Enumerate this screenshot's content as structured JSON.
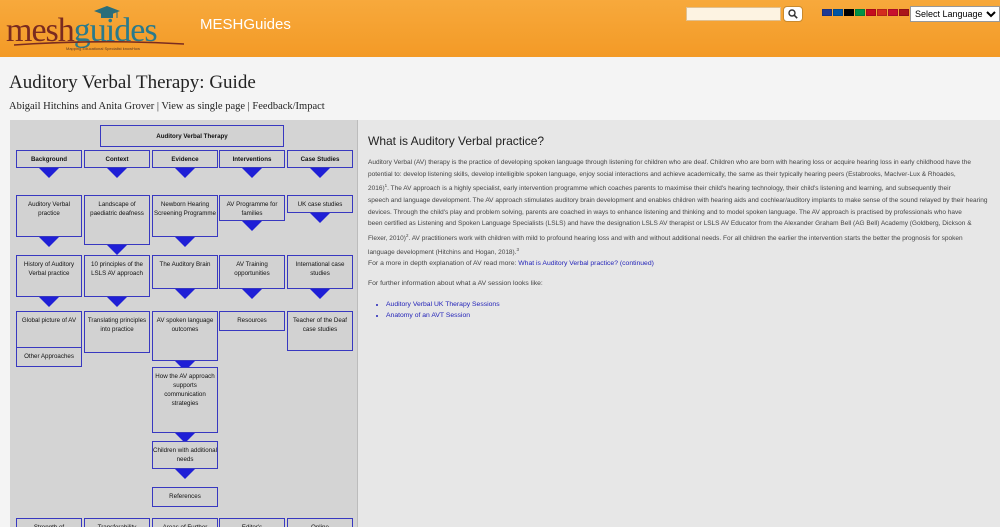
{
  "header": {
    "logo_text_1": "mesh",
    "logo_text_2": "guides",
    "logo_tagline": "Mapping Educational Specialist knowHow",
    "site_title": "MESHGuides",
    "search_placeholder": "",
    "language_select": "Select Language",
    "flags": [
      "#1f3a93",
      "#0055a4",
      "#000000",
      "#009246",
      "#c60b1e",
      "#d52b1e",
      "#c8102e",
      "#aa151b"
    ]
  },
  "page": {
    "title": "Auditory Verbal Therapy: Guide",
    "authors": "Abigail Hitchins and Anita Grover",
    "view_single": "View as single page",
    "feedback": "Feedback/Impact",
    "separator": "|"
  },
  "diagram": {
    "root": "Auditory Verbal Therapy",
    "columns": [
      {
        "head": "Background",
        "items": [
          "Auditory Verbal practice",
          "History of Auditory Verbal practice",
          "Global picture of AV",
          "Other Approaches",
          "Strength of"
        ]
      },
      {
        "head": "Context",
        "items": [
          "Landscape of paediatric deafness",
          "10 principles of the LSLS AV approach",
          "Translating principles into practice",
          "Transferability"
        ]
      },
      {
        "head": "Evidence",
        "items": [
          "Newborn Hearing Screening Programme",
          "The Auditory Brain",
          "AV spoken language outcomes",
          "How the AV approach supports communication strategies",
          "Children with additional needs",
          "References",
          "Areas of Further"
        ]
      },
      {
        "head": "Interventions",
        "items": [
          "AV Programme for families",
          "AV Training opportunities",
          "Resources",
          "Editor's"
        ]
      },
      {
        "head": "Case Studies",
        "items": [
          "UK case studies",
          "International case studies",
          "Teacher of the Deaf case studies",
          "Online"
        ]
      }
    ]
  },
  "content": {
    "heading": "What is Auditory Verbal practice?",
    "intro_lines": [
      "Auditory Verbal (AV) therapy is the practice of developing spoken language through listening for children who are deaf.  Children who are born with hearing loss or acquire hearing loss in early childhood have the",
      "potential to: develop listening skills, develop intelligible spoken language, enjoy social interactions and achieve academically, the same as their typically hearing peers (Estabrooks, MacIver-Lux & Rhoades,",
      "2016)",
      "speech and language development.  The AV approach stimulates auditory brain development and enables children with hearing aids and cochlear/auditory implants to make sense of the sound relayed by their hearing",
      "devices.  Through the child's play and problem solving, parents are coached in ways to enhance listening and thinking and to model spoken language.  The AV approach is practised by professionals who have",
      "been certified as Listening and Spoken Language Specialists (LSLS) and have the designation LSLS AV therapist or LSLS AV Educator from the Alexander Graham Bell (AG Bell) Academy (Goldberg, Dickson &",
      "Flexer, 2010)",
      "language development (Hitchins and Hogan, 2018)"
    ],
    "line3_rest": ".  The AV approach is a highly specialist, early intervention programme which coaches parents to maximise their child's hearing technology, their child's listening and learning, and subsequently their",
    "line7_rest": ".  AV practitioners work with children with mild to profound hearing loss and with and without additional needs.  For all children the earlier the intervention starts the better the prognosis for spoken",
    "fn1": "1",
    "fn2": "2",
    "fn3": "3",
    "line8_end": ".",
    "more_prefix": "For a more in depth explanation of AV read more:",
    "more_link": "What is Auditory Verbal practice? (continued)",
    "further": "For further information about what a AV session looks like:",
    "links": [
      "Auditory Verbal UK Therapy Sessions",
      "Anatomy of an AVT Session"
    ]
  }
}
